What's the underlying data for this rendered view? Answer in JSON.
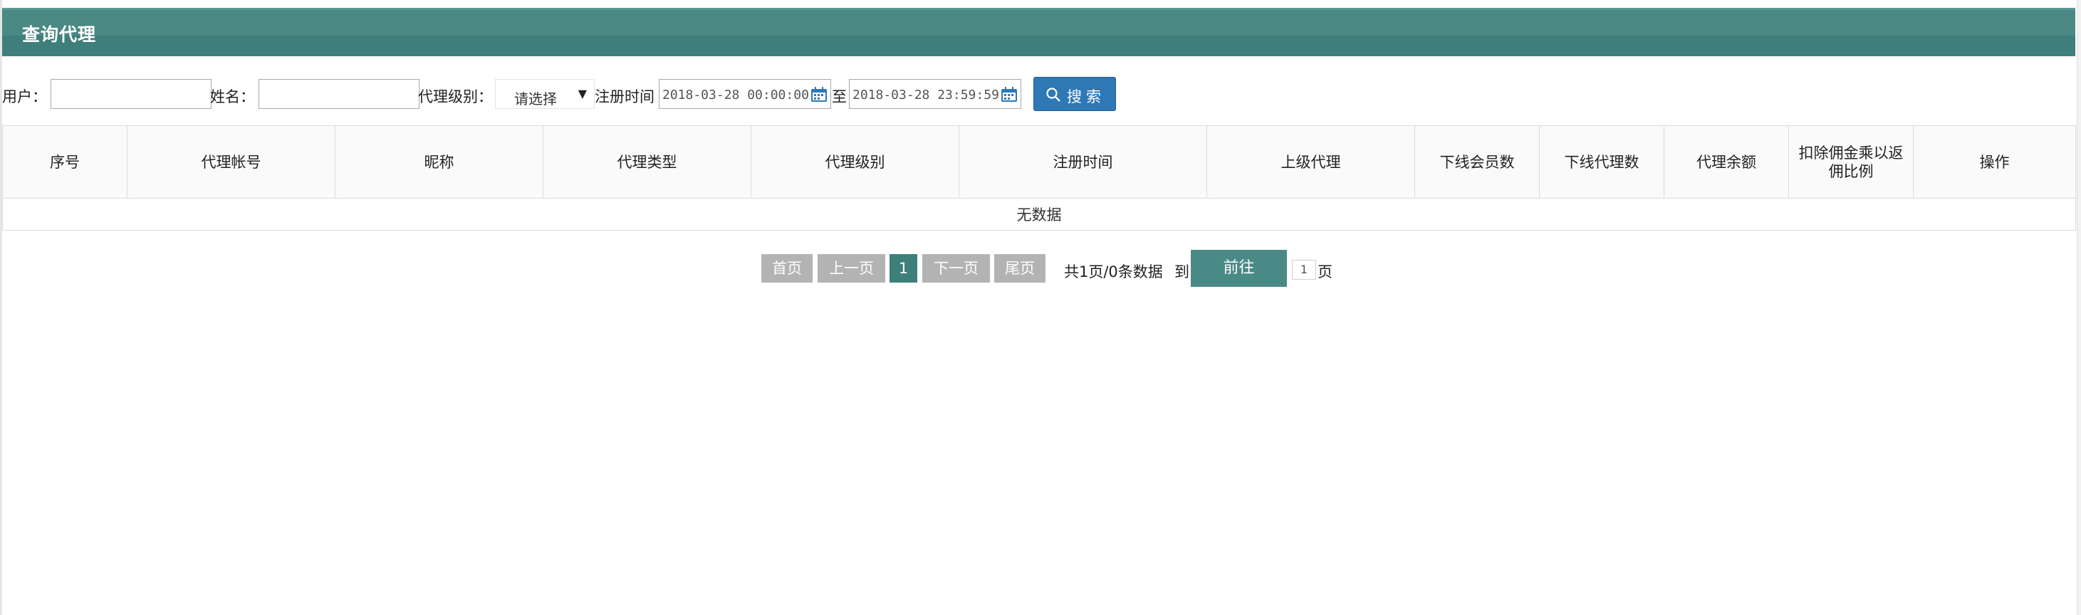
{
  "header": {
    "title": "查询代理"
  },
  "filters": {
    "user_label": "用户：",
    "user_value": "",
    "name_label": "姓名：",
    "name_value": "",
    "level_label": "代理级别：",
    "level_selected": "请选择",
    "reg_time_label": "注册时间",
    "date_from": "2018-03-28 00:00:00",
    "date_sep": "至",
    "date_to": "2018-03-28 23:59:59",
    "search_label": "搜索"
  },
  "table": {
    "columns": [
      "序号",
      "代理帐号",
      "昵称",
      "代理类型",
      "代理级别",
      "注册时间",
      "上级代理",
      "下线会员数",
      "下线代理数",
      "代理余额",
      "扣除佣金乘以返佣比例",
      "操作"
    ],
    "empty_text": "无数据"
  },
  "pager": {
    "first": "首页",
    "prev": "上一页",
    "current": "1",
    "next": "下一页",
    "last": "尾页",
    "summary": "共1页/0条数据",
    "goto_label": "到",
    "go_button": "前往",
    "page_input": "1",
    "page_unit": "页"
  },
  "colors": {
    "header_bg": "#3e7f7b",
    "search_button": "#2f78b6",
    "pager_active": "#3e7f7b",
    "pager_button": "#b3b3b3"
  },
  "icons": [
    "calendar-icon",
    "search-icon",
    "dropdown-arrow-icon"
  ]
}
